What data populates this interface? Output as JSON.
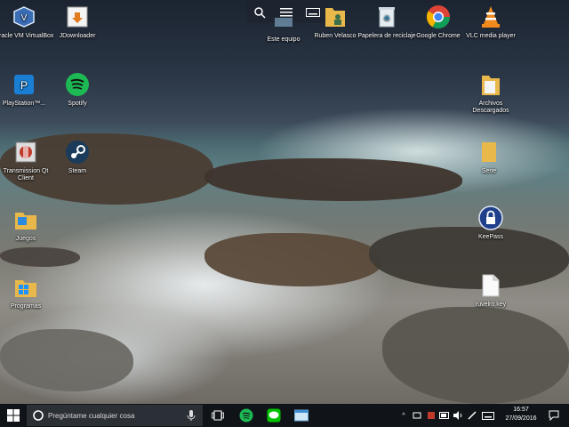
{
  "desktop_icons": [
    {
      "id": "virtualbox",
      "label": "Oracle VM VirtualBox"
    },
    {
      "id": "jdownloader",
      "label": "JDownloader"
    },
    {
      "id": "playstation",
      "label": "PlayStation™..."
    },
    {
      "id": "spotify",
      "label": "Spotify"
    },
    {
      "id": "transmission",
      "label": "Transmission Qt Client"
    },
    {
      "id": "steam",
      "label": "Steam"
    },
    {
      "id": "juegos",
      "label": "Juegos"
    },
    {
      "id": "programas",
      "label": "Programas"
    },
    {
      "id": "este-equipo",
      "label": "Este equipo"
    },
    {
      "id": "ruben",
      "label": "Ruben Velasco"
    },
    {
      "id": "papelera",
      "label": "Papelera de reciclaje"
    },
    {
      "id": "chrome",
      "label": "Google Chrome"
    },
    {
      "id": "vlc",
      "label": "VLC media player"
    },
    {
      "id": "archivos",
      "label": "Archivos Descargados"
    },
    {
      "id": "serie",
      "label": "Serie"
    },
    {
      "id": "keepass",
      "label": "KeePass"
    },
    {
      "id": "keyfile",
      "label": "ruvelro.key"
    }
  ],
  "taskbar": {
    "search_placeholder": "Pregúntame cualquier cosa",
    "time": "16:57",
    "date": "27/09/2016",
    "tray_caret": "^"
  },
  "icons": {
    "start": "windows-logo-icon",
    "search": "cortana-circle-icon",
    "mic": "microphone-icon",
    "task_view": "task-view-icon",
    "spotify": "spotify-icon",
    "line": "line-icon",
    "explorer": "explorer-icon",
    "keyboard": "keyboard-icon",
    "notifications": "notification-icon"
  },
  "colors": {
    "taskbar": "#101418",
    "search_box": "#2b2f36",
    "spotify_green": "#1db954",
    "chrome_red": "#db4437",
    "folder_yellow": "#e8b84a",
    "line_green": "#00c300"
  }
}
